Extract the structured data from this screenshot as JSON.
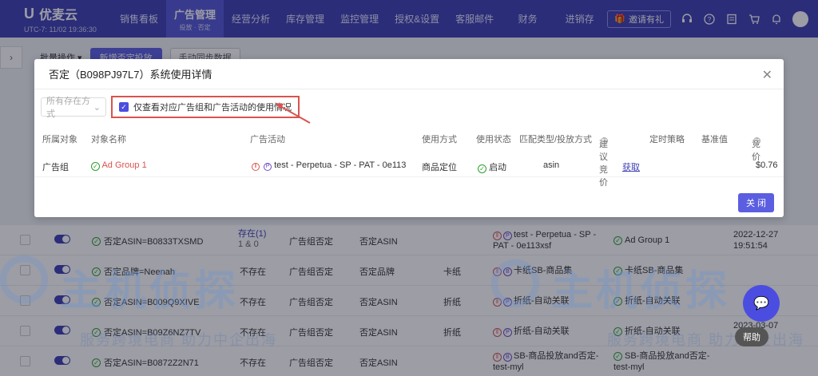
{
  "app": {
    "name": "优麦云",
    "time": "UTC-7: 11/02 19:36:30"
  },
  "nav": [
    {
      "label": "销售看板"
    },
    {
      "label": "广告管理",
      "sub": "投放 · 否定",
      "active": true
    },
    {
      "label": "经营分析"
    },
    {
      "label": "库存管理"
    },
    {
      "label": "监控管理"
    },
    {
      "label": "授权&设置"
    },
    {
      "label": "客服邮件"
    },
    {
      "label": "财务"
    },
    {
      "label": "进销存"
    }
  ],
  "header_right": {
    "invite": "邀请有礼"
  },
  "toolbar": {
    "bulk": "批量操作",
    "add_negative": "新增否定投放",
    "manual_sync": "手动同步数据"
  },
  "watermark": {
    "brand": "主机侦探",
    "slogan": "服务跨境电商 助力中企出海"
  },
  "modal": {
    "title": "否定（B098PJ97L7）系统使用详情",
    "filter_placeholder": "所有存在方式",
    "checkbox_label": "仅查看对应广告组和广告活动的使用情况",
    "columns": {
      "object": "所属对象",
      "name": "对象名称",
      "campaign": "广告活动",
      "method": "使用方式",
      "status": "使用状态",
      "match": "匹配类型/投放方式",
      "bid": "建议竞价",
      "schedule": "定时策略",
      "base": "基准值",
      "price": "竞价"
    },
    "row": {
      "object": "广告组",
      "name": "Ad Group 1",
      "campaign": "test - Perpetua - SP - PAT - 0e113",
      "method": "商品定位",
      "status": "启动",
      "match": "asin",
      "bid": "获取",
      "price": "$0.76"
    },
    "close": "关 闭"
  },
  "bg_rows": [
    {
      "target": "否定ASIN=B0833TXSMD",
      "exist": "存在(1)",
      "exist_count": "1 & 0",
      "level": "广告组否定",
      "type": "否定ASIN",
      "mode": "",
      "campaign": "test - Perpetua - SP - PAT - 0e113xsf",
      "group": "Ad Group 1",
      "date": "2022-12-27",
      "time": "19:51:54"
    },
    {
      "target": "否定品牌=Neenah",
      "exist": "不存在",
      "level": "广告组否定",
      "type": "否定品牌",
      "mode": "卡纸",
      "campaign": "卡纸SB-商品集",
      "group": "卡纸SB-商品集"
    },
    {
      "target": "否定ASIN=B009Q9XIVE",
      "exist": "不存在",
      "level": "广告组否定",
      "type": "否定ASIN",
      "mode": "折纸",
      "campaign": "折纸-自动关联",
      "group": "折纸-自动关联"
    },
    {
      "target": "否定ASIN=B09Z6NZ7TV",
      "exist": "不存在",
      "level": "广告组否定",
      "type": "否定ASIN",
      "mode": "折纸",
      "campaign": "折纸-自动关联",
      "group": "折纸-自动关联",
      "date": "2023-03-07"
    },
    {
      "target": "否定ASIN=B0872Z2N71",
      "exist": "不存在",
      "level": "广告组否定",
      "type": "否定ASIN",
      "mode": "",
      "campaign": "SB-商品投放and否定-test-myl",
      "group": "SB-商品投放and否定-test-myl"
    }
  ],
  "fab": {
    "help": "帮助"
  },
  "colors": {
    "nav_bg": "#3d3fb3",
    "accent": "#5b5ee0",
    "danger": "#d9534f",
    "success": "#2ca02c"
  }
}
